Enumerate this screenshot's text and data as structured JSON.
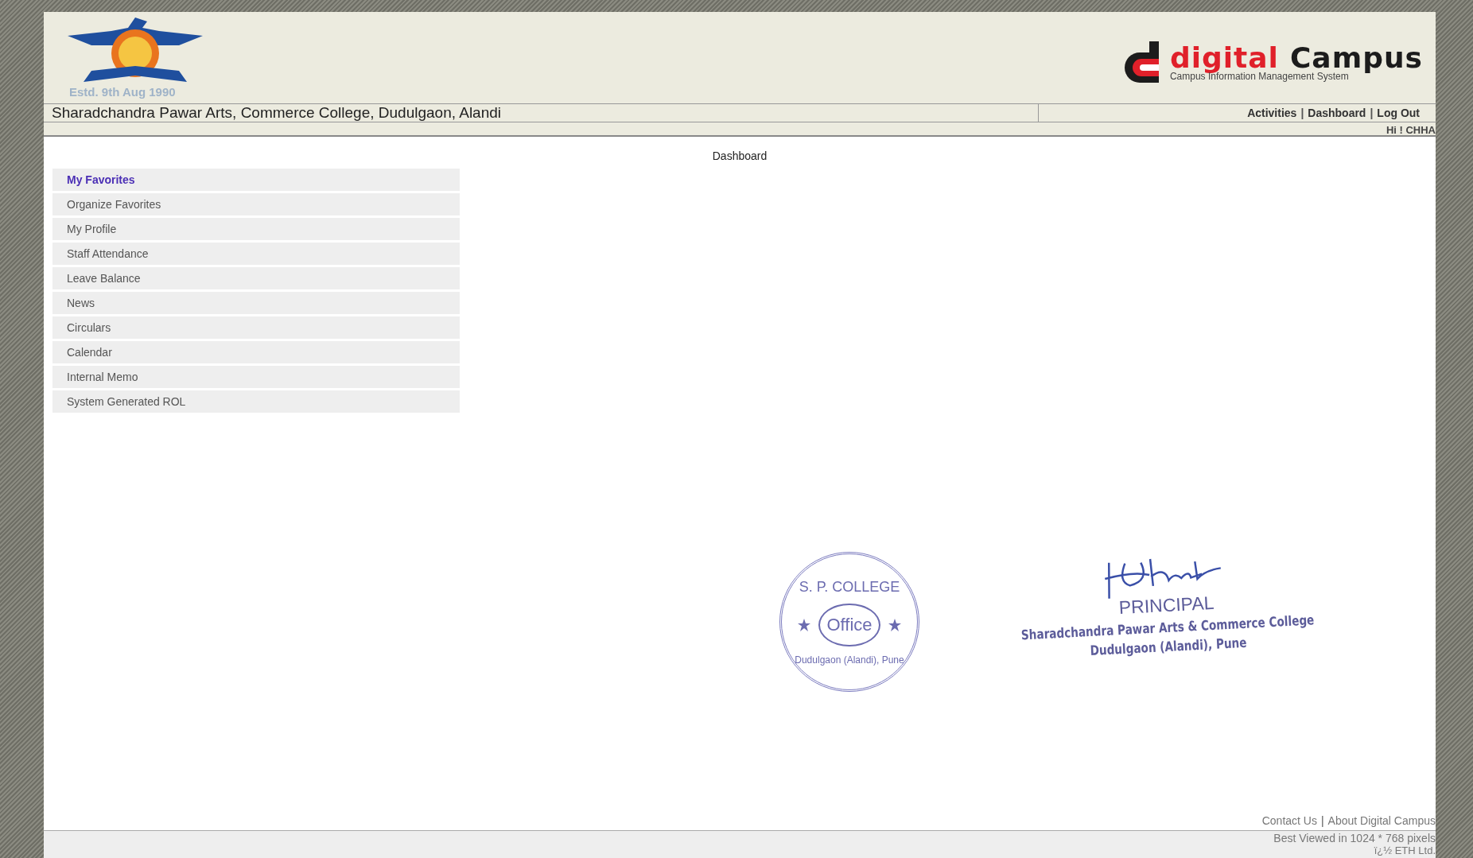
{
  "header": {
    "estd": "Estd. 9th Aug 1990",
    "brand": {
      "word1": "digital",
      "word2": "Campus",
      "tagline": "Campus Information Management System"
    },
    "college_name": "Sharadchandra Pawar Arts, Commerce College, Dudulgaon, Alandi",
    "nav_links": [
      "Activities",
      "Dashboard",
      "Log Out"
    ],
    "separator": "|",
    "greeting": "Hi ! CHHA"
  },
  "page_title": "Dashboard",
  "sidebar": {
    "items": [
      {
        "label": "My Favorites",
        "selected": true
      },
      {
        "label": "Organize Favorites",
        "selected": false
      },
      {
        "label": "My Profile",
        "selected": false
      },
      {
        "label": "Staff Attendance",
        "selected": false
      },
      {
        "label": "Leave Balance",
        "selected": false
      },
      {
        "label": "News",
        "selected": false
      },
      {
        "label": "Circulars",
        "selected": false
      },
      {
        "label": "Calendar",
        "selected": false
      },
      {
        "label": "Internal Memo",
        "selected": false
      },
      {
        "label": "System Generated ROL",
        "selected": false
      }
    ]
  },
  "stamp": {
    "top": "S. P. COLLEGE",
    "center": "Office",
    "bottom": "Dudulgaon (Alandi), Pune"
  },
  "signature": {
    "title": "PRINCIPAL",
    "lines": [
      "Sharadchandra Pawar Arts & Commerce College",
      "Dudulgaon (Alandi), Pune"
    ]
  },
  "footer": {
    "links": [
      "Contact Us",
      "About Digital Campus"
    ],
    "separator": "|",
    "best_viewed": "Best Viewed in 1024 * 768 pixels",
    "copyright": "ï¿½ ETH Ltd."
  }
}
